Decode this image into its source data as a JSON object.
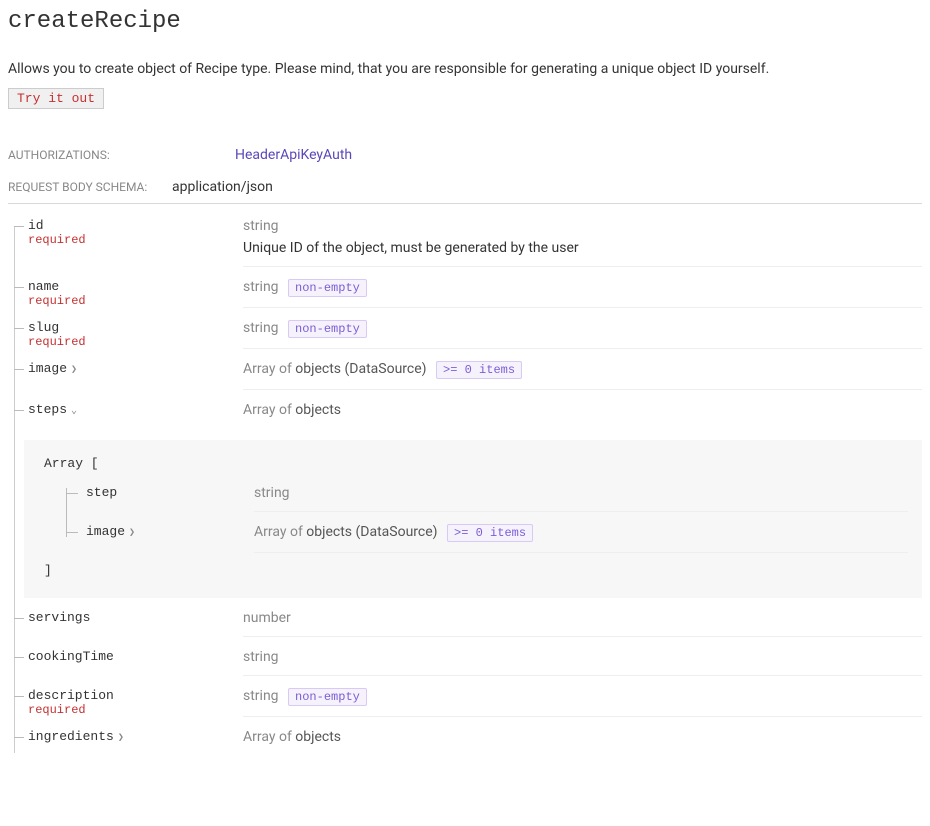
{
  "title": "createRecipe",
  "description": "Allows you to create object of Recipe type. Please mind, that you are responsible for generating a unique object ID yourself.",
  "try_button": "Try it out",
  "auth": {
    "label": "AUTHORIZATIONS:",
    "value": "HeaderApiKeyAuth"
  },
  "body_schema": {
    "label": "REQUEST BODY SCHEMA:",
    "value": "application/json"
  },
  "required": "required",
  "types": {
    "string": "string",
    "number": "number",
    "array_of": "Array of ",
    "objects": "objects",
    "objects_ds": "objects (DataSource)"
  },
  "badges": {
    "nonempty": "non-empty",
    "zero_items": ">= 0 items"
  },
  "fields": {
    "id": {
      "name": "id",
      "desc": "Unique ID of the object, must be generated by the user"
    },
    "name": {
      "name": "name"
    },
    "slug": {
      "name": "slug"
    },
    "image": {
      "name": "image"
    },
    "steps": {
      "name": "steps"
    },
    "servings": {
      "name": "servings"
    },
    "cookingTime": {
      "name": "cookingTime"
    },
    "description": {
      "name": "description"
    },
    "ingredients": {
      "name": "ingredients"
    }
  },
  "nested": {
    "array_open": "Array [",
    "array_close": "]",
    "step": {
      "name": "step"
    },
    "image": {
      "name": "image"
    }
  }
}
